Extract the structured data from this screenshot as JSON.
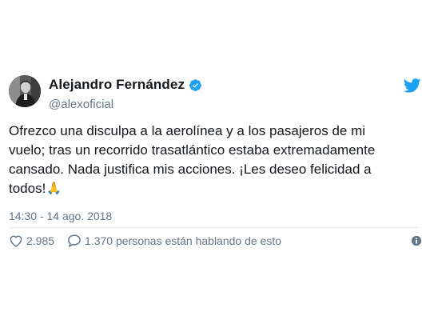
{
  "tweet": {
    "author": {
      "display_name": "Alejandro Fernández",
      "handle": "@alexoficial",
      "verified": true,
      "avatar_icon": "profile-photo"
    },
    "text_lines": [
      "Ofrezco una disculpa a la aerolínea y a los pasajeros de mi",
      "vuelo; tras un recorrido trasatlántico estaba extremadamente",
      "cansado. Nada justifica mis acciones. ¡Les deseo felicidad a",
      "todos!"
    ],
    "emoji": "🙏",
    "timestamp": "14:30 - 14 ago. 2018",
    "likes_count": "2.985",
    "replies_text": "1.370 personas están hablando de esto"
  },
  "icons": {
    "platform": "twitter-bird-icon",
    "verified": "verified-badge-icon",
    "like": "heart-icon",
    "reply": "speech-bubble-icon",
    "info": "info-icon"
  },
  "colors": {
    "brand_blue": "#1da1f2",
    "text_primary": "#14171a",
    "text_secondary": "#657786"
  }
}
